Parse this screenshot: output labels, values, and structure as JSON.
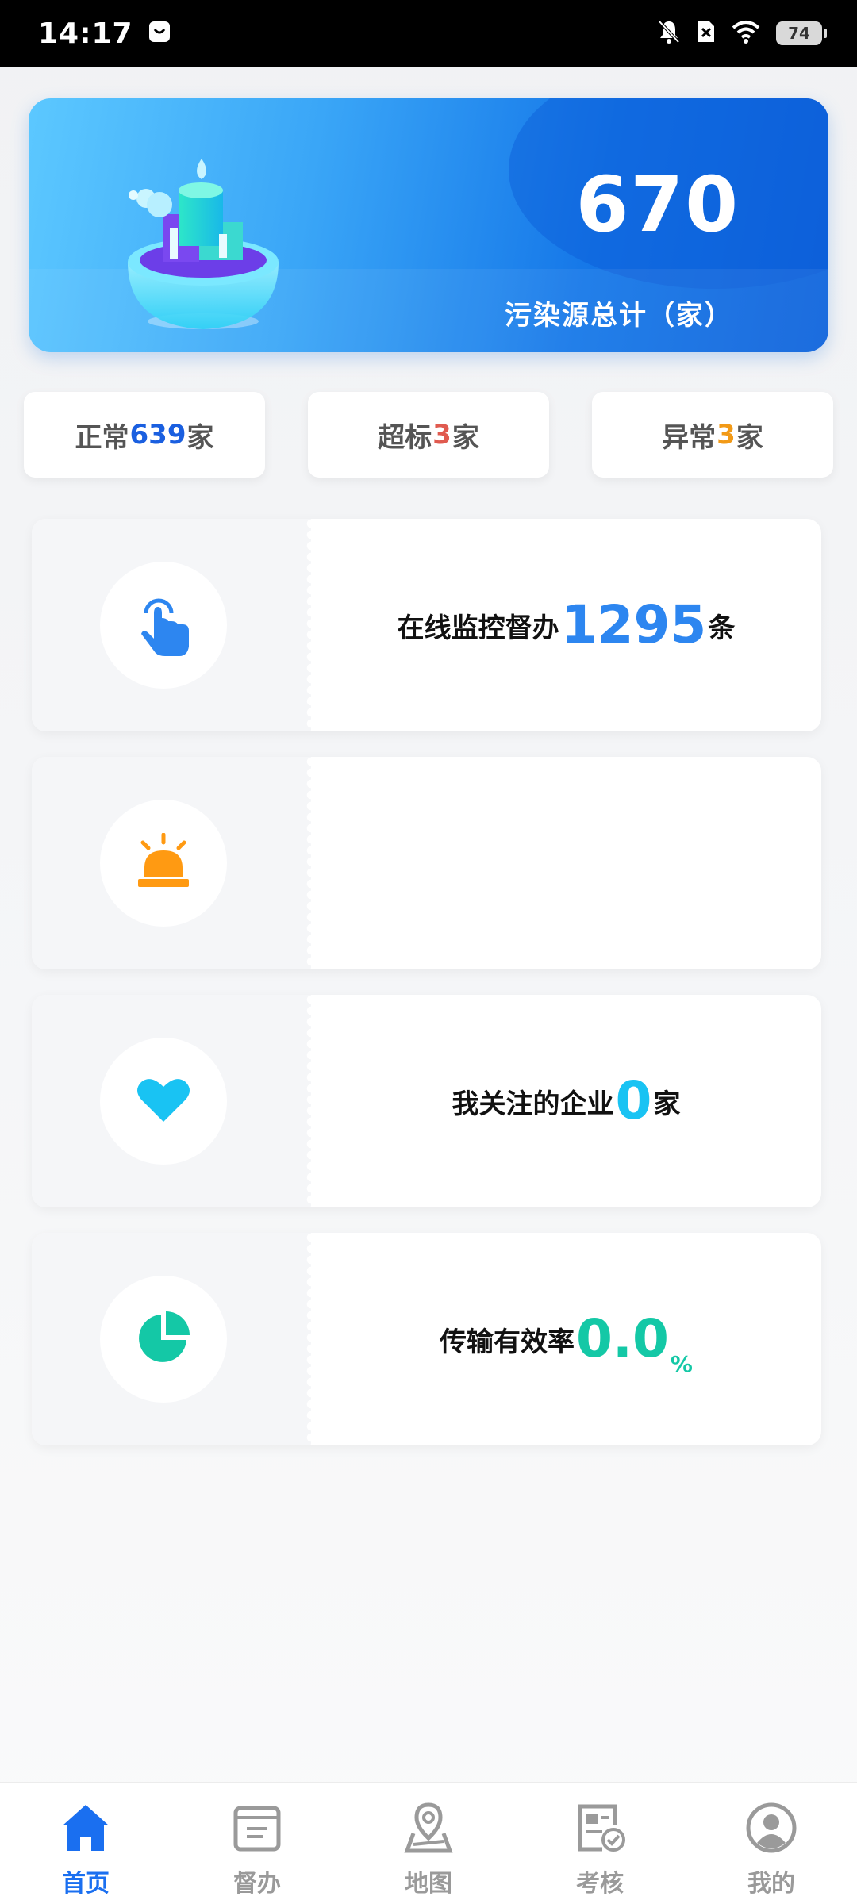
{
  "status_bar": {
    "time": "14:17",
    "battery": "74"
  },
  "banner": {
    "total": "670",
    "label": "污染源总计（家）"
  },
  "stats": [
    {
      "prefix": "正常",
      "count": "639",
      "suffix": "家",
      "color": "#1a5fe0"
    },
    {
      "prefix": "超标",
      "count": "3",
      "suffix": "家",
      "color": "#e05a4f"
    },
    {
      "prefix": "异常",
      "count": "3",
      "suffix": "家",
      "color": "#f29a17"
    }
  ],
  "cards": {
    "supervision": {
      "label": "在线监控督办",
      "count": "1295",
      "unit": "条",
      "icon": "tap-hand-icon",
      "color": "#2d86f0"
    },
    "alarm": {
      "icon": "alarm-light-icon",
      "color": "#ff9a12"
    },
    "followed": {
      "label": "我关注的企业",
      "count": "0",
      "unit": "家",
      "icon": "heart-icon",
      "color": "#19c3f3"
    },
    "transmission": {
      "label": "传输有效率",
      "count": "0.0",
      "unit": "%",
      "icon": "pie-chart-icon",
      "color": "#14c8a6"
    }
  },
  "nav": [
    {
      "label": "首页",
      "icon": "home-icon",
      "active": true
    },
    {
      "label": "督办",
      "icon": "document-icon",
      "active": false
    },
    {
      "label": "地图",
      "icon": "map-pin-icon",
      "active": false
    },
    {
      "label": "考核",
      "icon": "check-report-icon",
      "active": false
    },
    {
      "label": "我的",
      "icon": "user-icon",
      "active": false
    }
  ]
}
